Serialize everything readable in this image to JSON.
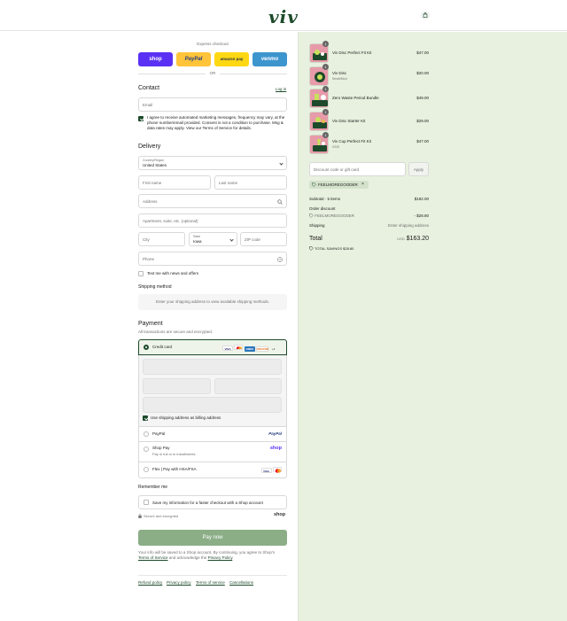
{
  "header": {
    "logo": "viv",
    "cart_icon": "shopping-bag-icon"
  },
  "express": {
    "label": "Express checkout",
    "or": "OR",
    "buttons": [
      {
        "label": "shop",
        "color": "#5a31f4",
        "text_color": "#ffffff"
      },
      {
        "label": "PayPal",
        "color": "#ffc439",
        "text_color": "#253b80"
      },
      {
        "label": "amazon pay",
        "color": "#ffd814",
        "text_color": "#232f3e"
      },
      {
        "label": "venmo",
        "color": "#3d95ce",
        "text_color": "#ffffff"
      }
    ]
  },
  "contact": {
    "title": "Contact",
    "login": "Log in",
    "email_placeholder": "Email",
    "consent": "I agree to receive automated marketing messages, frequency may vary, at the phone number/email provided. Consent is not a condition to purchase. Msg & data rates may apply. View our Terms of Service for details."
  },
  "delivery": {
    "title": "Delivery",
    "country_label": "Country/Region",
    "country_value": "United States",
    "first_name": "First name",
    "last_name": "Last name",
    "address": "Address",
    "apartment": "Apartment, suite, etc. (optional)",
    "city": "City",
    "state_label": "State",
    "state_value": "Iowa",
    "zip": "ZIP code",
    "phone": "Phone",
    "text_me": "Text me with news and offers"
  },
  "shipping": {
    "title": "Shipping method",
    "placeholder": "Enter your shipping address to view available shipping methods."
  },
  "payment": {
    "title": "Payment",
    "subtitle": "All transactions are secure and encrypted.",
    "credit_card": "Credit card",
    "card_brands": [
      "VISA",
      "MC",
      "AMEX",
      "DISCOVER"
    ],
    "more": "+4",
    "billing_same": "Use shipping address as billing address",
    "paypal": "PayPal",
    "paypal_logo": "PayPal",
    "shop_pay": "Shop Pay",
    "shop_pay_sub": "Pay in full or in installments",
    "shop_logo": "shop",
    "flex": "Flex | Pay with HSA/FSA"
  },
  "remember": {
    "title": "Remember me",
    "save": "Save my information for a faster checkout with a Shop account",
    "secure": "Secure and encrypted",
    "shop_logo": "shop"
  },
  "pay_button": "Pay now",
  "legal": {
    "line1": "Your info will be saved to a Shop account. By continuing, you agree to Shop's",
    "tos": "Terms of Service",
    "and": " and acknowledge the ",
    "privacy": "Privacy Policy",
    "end": "."
  },
  "footer_links": [
    "Refund policy",
    "Privacy policy",
    "Terms of service",
    "Cancellations"
  ],
  "cart": {
    "items": [
      {
        "name": "Viv Disc Perfect Fit Kit",
        "sub": "",
        "price": "$47.00",
        "qty": "1"
      },
      {
        "name": "Viv Disc",
        "sub": "Small/Mod",
        "price": "$20.00",
        "qty": "1"
      },
      {
        "name": "Zero Waste Period Bundle",
        "sub": "",
        "price": "$49.00",
        "qty": "1"
      },
      {
        "name": "Viv Disc Starter Kit",
        "sub": "",
        "price": "$29.00",
        "qty": "1"
      },
      {
        "name": "Viv Cup Perfect Fit Kit",
        "sub": "XS/S",
        "price": "$47.00",
        "qty": "1"
      }
    ],
    "discount_placeholder": "Discount code or gift card",
    "apply": "Apply",
    "code_tag": "FEELMOREGOODER",
    "subtotal_label": "Subtotal · 5 items",
    "subtotal": "$192.00",
    "order_discount": "Order discount",
    "discount_code": "FEELMOREGOODER",
    "discount_value": "- $28.80",
    "shipping_label": "Shipping",
    "shipping_value": "Enter shipping address",
    "total_label": "Total",
    "currency": "USD",
    "total": "$163.20",
    "savings": "TOTAL SAVINGS  $28.80"
  }
}
